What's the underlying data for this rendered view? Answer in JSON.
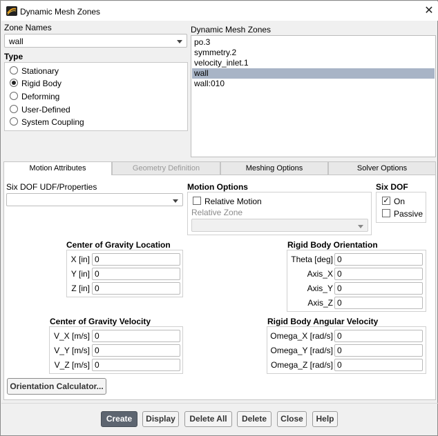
{
  "window": {
    "title": "Dynamic Mesh Zones",
    "close_glyph": "✕"
  },
  "zone_names": {
    "label": "Zone Names",
    "value": "wall"
  },
  "type": {
    "label": "Type",
    "options": [
      "Stationary",
      "Rigid Body",
      "Deforming",
      "User-Defined",
      "System Coupling"
    ],
    "selected": "Rigid Body"
  },
  "dynamic_zones": {
    "label": "Dynamic Mesh Zones",
    "items": [
      "po.3",
      "symmetry.2",
      "velocity_inlet.1",
      "wall",
      "wall:010"
    ],
    "selected": "wall"
  },
  "tabs": [
    {
      "label": "Motion Attributes",
      "active": true,
      "enabled": true
    },
    {
      "label": "Geometry Definition",
      "active": false,
      "enabled": false
    },
    {
      "label": "Meshing Options",
      "active": false,
      "enabled": true
    },
    {
      "label": "Solver Options",
      "active": false,
      "enabled": true
    }
  ],
  "six_dof_udf": {
    "label": "Six DOF UDF/Properties",
    "value": ""
  },
  "motion_options": {
    "label": "Motion Options",
    "relative_motion": {
      "label": "Relative Motion",
      "checked": false
    },
    "relative_zone": {
      "label": "Relative Zone",
      "value": ""
    }
  },
  "six_dof": {
    "label": "Six DOF",
    "on": {
      "label": "On",
      "checked": true
    },
    "passive": {
      "label": "Passive",
      "checked": false
    }
  },
  "cg_location": {
    "label": "Center of Gravity Location",
    "fields": [
      {
        "label": "X [in]",
        "value": "0"
      },
      {
        "label": "Y [in]",
        "value": "0"
      },
      {
        "label": "Z [in]",
        "value": "0"
      }
    ]
  },
  "orientation": {
    "label": "Rigid Body Orientation",
    "fields": [
      {
        "label": "Theta [deg]",
        "value": "0"
      },
      {
        "label": "Axis_X",
        "value": "0"
      },
      {
        "label": "Axis_Y",
        "value": "0"
      },
      {
        "label": "Axis_Z",
        "value": "0"
      }
    ]
  },
  "cg_velocity": {
    "label": "Center of Gravity Velocity",
    "fields": [
      {
        "label": "V_X [m/s]",
        "value": "0"
      },
      {
        "label": "V_Y [m/s]",
        "value": "0"
      },
      {
        "label": "V_Z [m/s]",
        "value": "0"
      }
    ]
  },
  "angular_velocity": {
    "label": "Rigid Body Angular Velocity",
    "fields": [
      {
        "label": "Omega_X [rad/s]",
        "value": "0"
      },
      {
        "label": "Omega_Y [rad/s]",
        "value": "0"
      },
      {
        "label": "Omega_Z [rad/s]",
        "value": "0"
      }
    ]
  },
  "orientation_calculator": "Orientation Calculator...",
  "buttons": {
    "create": "Create",
    "display": "Display",
    "delete_all": "Delete All",
    "delete": "Delete",
    "close": "Close",
    "help": "Help"
  },
  "colors": {
    "selection": "#a8b4c6",
    "primary_button": "#5d6570"
  }
}
